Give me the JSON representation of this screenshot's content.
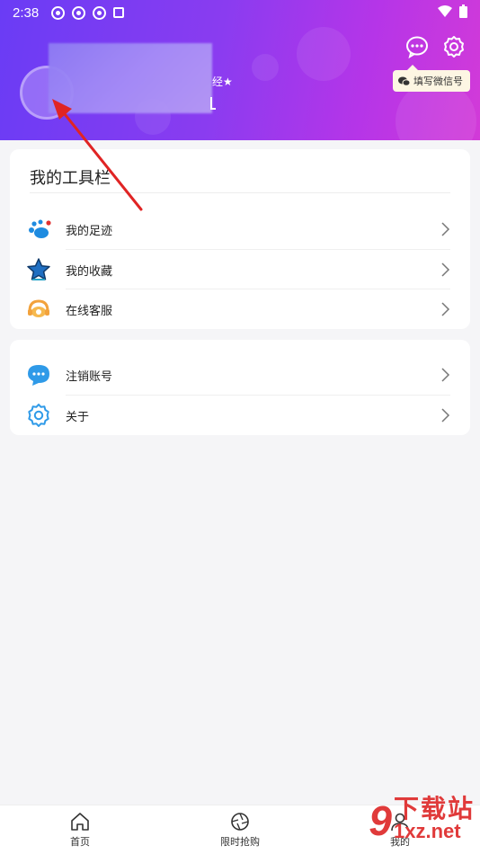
{
  "status": {
    "time": "2:38"
  },
  "header": {
    "wechat_tag": "填写微信号",
    "name_suffix": "经",
    "wechat_icon": "wechat-icon",
    "message_icon": "message-icon",
    "settings_icon": "settings-icon"
  },
  "tools": {
    "title": "我的工具栏",
    "items": [
      {
        "label": "我的足迹",
        "icon": "footprint-icon"
      },
      {
        "label": "我的收藏",
        "icon": "star-icon"
      },
      {
        "label": "在线客服",
        "icon": "headset-icon"
      }
    ]
  },
  "account": {
    "items": [
      {
        "label": "注销账号",
        "icon": "chat-bubble-icon"
      },
      {
        "label": "关于",
        "icon": "gear-icon"
      }
    ]
  },
  "nav": {
    "items": [
      {
        "label": "首页",
        "icon": "home-icon"
      },
      {
        "label": "限时抢购",
        "icon": "shutter-icon"
      },
      {
        "label": "我的",
        "icon": "user-icon"
      }
    ]
  },
  "watermark": {
    "digit": "9",
    "top": "下载站",
    "bottom": "1xz.net"
  },
  "colors": {
    "header_start": "#6a3cf5",
    "header_end": "#d23ad8",
    "arrow": "#e02424",
    "accent_blue": "#2f9ae8",
    "accent_orange": "#f2a23c"
  }
}
